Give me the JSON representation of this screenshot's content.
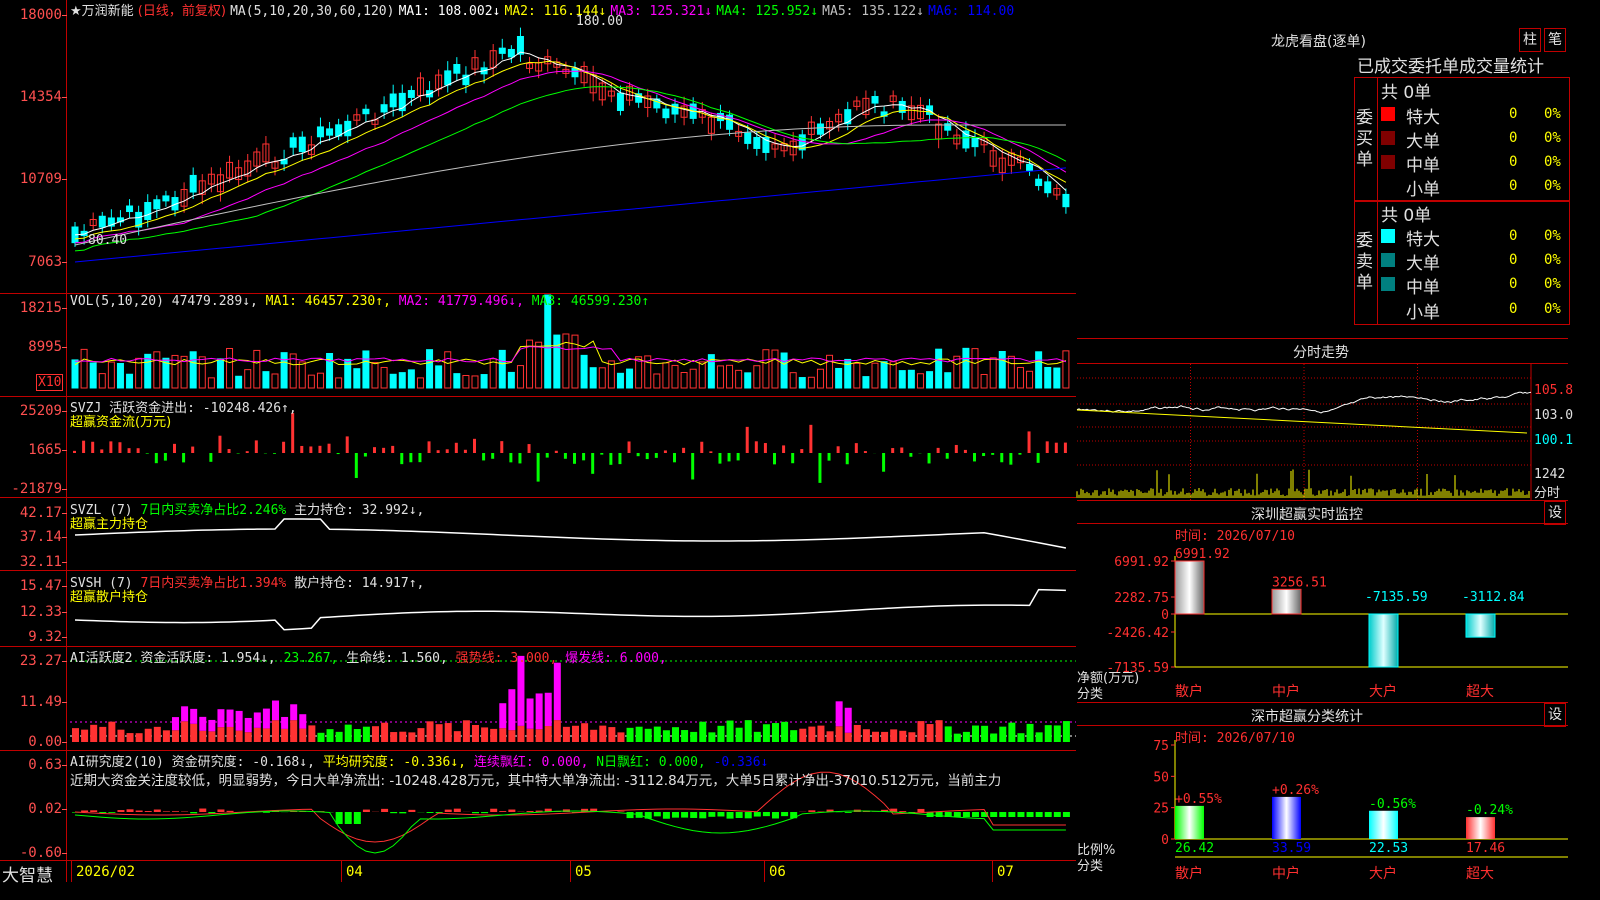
{
  "stock": {
    "name": "★万润新能",
    "mode": "(日线，前复权)",
    "ma_header": "MA(5,10,20,30,60,120)",
    "ma": [
      {
        "label": "MA1: 108.002↓",
        "color": "#ffffff"
      },
      {
        "label": "MA2: 116.144↓",
        "color": "#ffff00"
      },
      {
        "label": "MA3: 125.321↓",
        "color": "#ff00ff"
      },
      {
        "label": "MA4: 125.952↓",
        "color": "#00ff00"
      },
      {
        "label": "MA5: 135.122↓",
        "color": "#c0c0c0"
      },
      {
        "label": "MA6: 114.00",
        "color": "#0000ff"
      }
    ],
    "high_label": "180.00",
    "low_label": "80.40",
    "price_axis": [
      "18000",
      "14354",
      "10709",
      "7063"
    ]
  },
  "volume": {
    "header": "VOL(5,10,20)",
    "value": "47479.289↓,",
    "ma1": "MA1: 46457.230↑,",
    "ma2": "MA2: 41779.496↓,",
    "ma3": "MA3: 46599.230↑",
    "axis": [
      "18215",
      "8995"
    ],
    "unit": "X10"
  },
  "svzj": {
    "header": "SVZJ",
    "label": "活跃资金进出: -10248.426↑,",
    "subtitle": "超赢资金流(万元)",
    "axis": [
      "25209",
      "1665",
      "-21879"
    ]
  },
  "svzl": {
    "header": "SVZL (7)",
    "ratio": "7日内买卖净占比2.246%",
    "label": "主力持仓: 32.992↓,",
    "subtitle": "超赢主力持仓",
    "axis": [
      "42.17",
      "37.14",
      "32.11"
    ]
  },
  "svsh": {
    "header": "SVSH (7)",
    "ratio": "7日内买卖净占比1.394%",
    "label": "散户持仓: 14.917↑,",
    "subtitle": "超赢散户持仓",
    "axis": [
      "15.47",
      "12.33",
      "9.32"
    ]
  },
  "ai_active": {
    "header": "AI活跃度2",
    "label": "资金活跃度: 1.954↓,",
    "v2": "23.267,",
    "life": "生命线: 1.560,",
    "strong": "强势线: 3.000,",
    "burst": "爆发线: 6.000,",
    "axis": [
      "23.27",
      "11.49",
      "0.00"
    ]
  },
  "ai_research": {
    "header": "AI研究度2(10)",
    "label": "资金研究度: -0.168↓,",
    "avg": "平均研究度: -0.336↓,",
    "cont": "连续飘红: 0.000,",
    "n": "N日飘红: 0.000,",
    "last": "-0.336↓",
    "comment": "近期大资金关注度较低，明显弱势，今日大单净流出: -10248.428万元，其中特大单净流出: -3112.84万元，大单5日累计净出-37010.512万元，当前主力",
    "axis": [
      "0.63",
      "0.02",
      "-0.60"
    ]
  },
  "xaxis": {
    "brand": "大智慧",
    "labels": [
      {
        "text": "2026/02",
        "pos": 75
      },
      {
        "text": "04",
        "pos": 345
      },
      {
        "text": "05",
        "pos": 574
      },
      {
        "text": "06",
        "pos": 768
      },
      {
        "text": "07",
        "pos": 996
      }
    ]
  },
  "longhu": {
    "title": "龙虎看盘(逐单)",
    "btn1": "柱",
    "btn2": "笔",
    "tabs": "已成交委托单成交量统计",
    "buy_label": "委买单",
    "sell_label": "委卖单",
    "buy_total": "共 0单",
    "sell_total": "共 0单",
    "buy_rows": [
      {
        "name": "特大",
        "count": "0",
        "pct": "0%",
        "color": "#ff0000"
      },
      {
        "name": "大单",
        "count": "0",
        "pct": "0%",
        "color": "#800000"
      },
      {
        "name": "中单",
        "count": "0",
        "pct": "0%",
        "color": "#800000"
      },
      {
        "name": "小单",
        "count": "0",
        "pct": "0%",
        "color": "#000000"
      }
    ],
    "sell_rows": [
      {
        "name": "特大",
        "count": "0",
        "pct": "0%",
        "color": "#00ffff"
      },
      {
        "name": "大单",
        "count": "0",
        "pct": "0%",
        "color": "#008080"
      },
      {
        "name": "中单",
        "count": "0",
        "pct": "0%",
        "color": "#008080"
      },
      {
        "name": "小单",
        "count": "0",
        "pct": "0%",
        "color": "#000000"
      }
    ]
  },
  "intraday": {
    "title": "分时走势",
    "axis": [
      "105.8",
      "103.0",
      "100.1"
    ],
    "vol_label": "1242",
    "unit": "分时"
  },
  "sz_monitor": {
    "title": "深圳超赢实时监控",
    "btn": "设",
    "time": "时间: 2026/07/10",
    "axis": [
      "6991.92",
      "2282.75",
      "0",
      "-2426.42",
      "-7135.59"
    ],
    "ylabel": "净额(万元)",
    "xlabel": "分类",
    "bars": [
      {
        "cat": "散户",
        "value": 6991.92,
        "label": "6991.92"
      },
      {
        "cat": "中户",
        "value": 3256.51,
        "label": "3256.51"
      },
      {
        "cat": "大户",
        "value": -7135.59,
        "label": "-7135.59"
      },
      {
        "cat": "超大",
        "value": -3112.84,
        "label": "-3112.84"
      }
    ]
  },
  "sz_class": {
    "title": "深市超赢分类统计",
    "btn": "设",
    "time": "时间: 2026/07/10",
    "axis": [
      "75",
      "50",
      "25",
      "0"
    ],
    "ylabel": "比例%",
    "xlabel": "分类",
    "bars": [
      {
        "cat": "散户",
        "value": 26.42,
        "label": "26.42",
        "change": "+0.55%"
      },
      {
        "cat": "中户",
        "value": 33.59,
        "label": "33.59",
        "change": "+0.26%"
      },
      {
        "cat": "大户",
        "value": 22.53,
        "label": "22.53",
        "change": "-0.56%"
      },
      {
        "cat": "超大",
        "value": 17.46,
        "label": "17.46",
        "change": "-0.24%"
      }
    ]
  },
  "colors": {
    "up": "#ff3232",
    "down": "#00ffff",
    "grid": "#c00000",
    "ma1": "#ffffff",
    "ma2": "#ffff00",
    "ma3": "#ff00ff",
    "ma4": "#00ff00",
    "ma5": "#c0c0c0",
    "ma6": "#0000ff"
  }
}
